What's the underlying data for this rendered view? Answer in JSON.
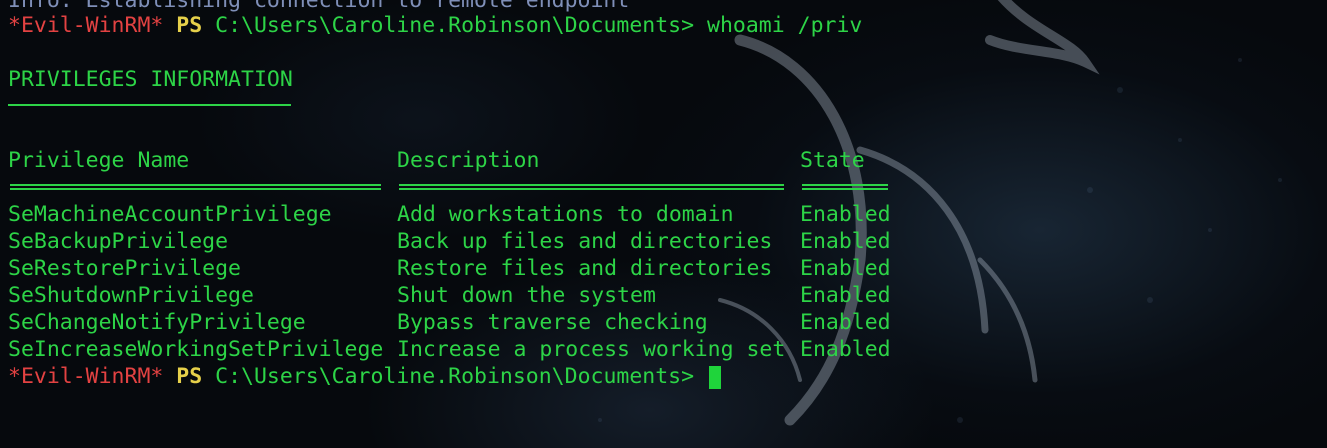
{
  "status_line": "Info: Establishing connection to remote endpoint",
  "prompt": {
    "shell_tag": "*Evil-WinRM*",
    "ps_label": "PS",
    "path": "C:\\Users\\Caroline.Robinson\\Documents>",
    "command": "whoami /priv"
  },
  "section_heading": "PRIVILEGES INFORMATION",
  "table": {
    "headers": [
      "Privilege Name",
      "Description",
      "State"
    ],
    "rows": [
      [
        "SeMachineAccountPrivilege",
        "Add workstations to domain",
        "Enabled"
      ],
      [
        "SeBackupPrivilege",
        "Back up files and directories",
        "Enabled"
      ],
      [
        "SeRestorePrivilege",
        "Restore files and directories",
        "Enabled"
      ],
      [
        "SeShutdownPrivilege",
        "Shut down the system",
        "Enabled"
      ],
      [
        "SeChangeNotifyPrivilege",
        "Bypass traverse checking",
        "Enabled"
      ],
      [
        "SeIncreaseWorkingSetPrivilege",
        "Increase a process working set",
        "Enabled"
      ]
    ]
  },
  "colors": {
    "background": "#06090d",
    "prompt_tag": "#e34242",
    "ps_label": "#e6d04a",
    "output_text": "#2dd447",
    "status_text": "#7f8fb8",
    "cursor": "#1fd43b"
  }
}
